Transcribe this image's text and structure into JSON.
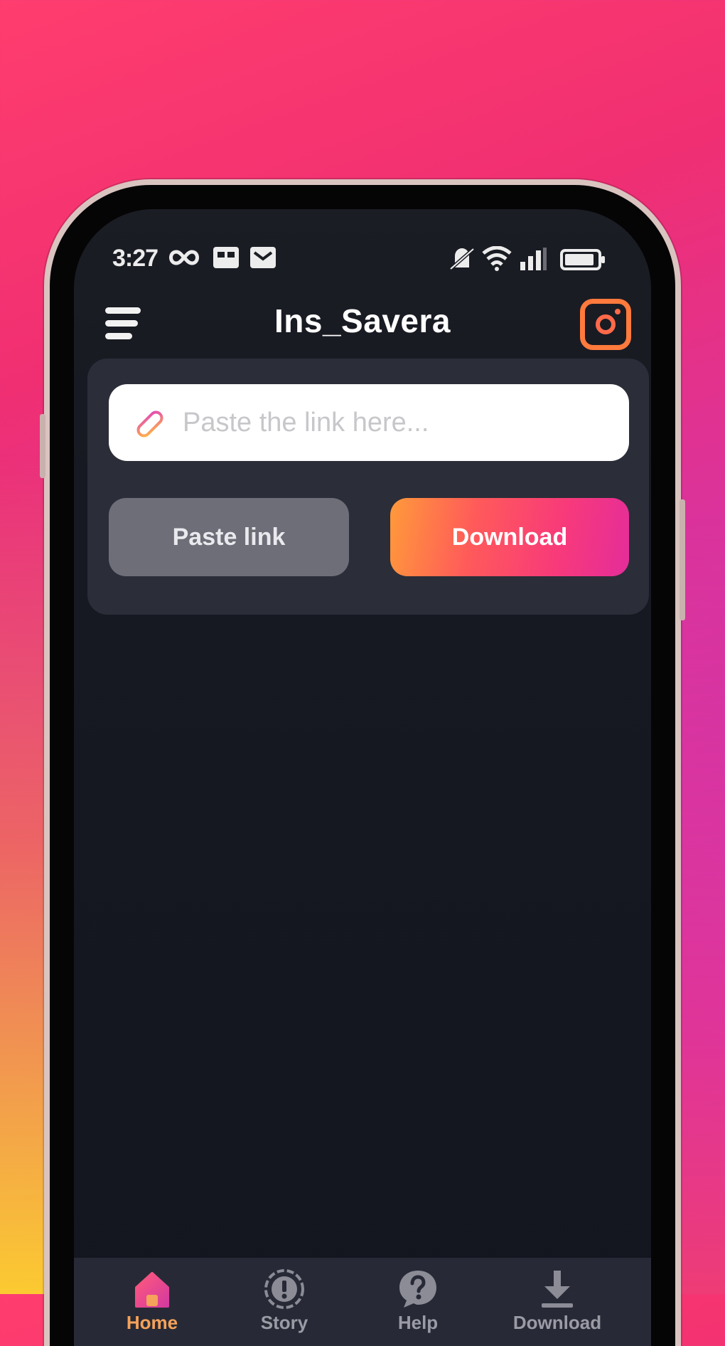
{
  "status_bar": {
    "time": "3:27"
  },
  "header": {
    "title": "Ins_Savera"
  },
  "link_input": {
    "placeholder": "Paste the link here..."
  },
  "buttons": {
    "paste_label": "Paste link",
    "download_label": "Download"
  },
  "nav": {
    "items": [
      {
        "label": "Home",
        "icon": "home-icon",
        "active": true
      },
      {
        "label": "Story",
        "icon": "story-icon",
        "active": false
      },
      {
        "label": "Help",
        "icon": "help-icon",
        "active": false
      },
      {
        "label": "Download",
        "icon": "download-icon",
        "active": false
      }
    ]
  },
  "colors": {
    "screen_bg": "#161822",
    "card_bg": "#2b2d38",
    "paste_button": "#6d6e78",
    "download_gradient_start": "#ff9a3a",
    "download_gradient_end": "#e42d9a",
    "active_nav": "#f5a25a",
    "instagram_orange": "#ff7a3c"
  }
}
